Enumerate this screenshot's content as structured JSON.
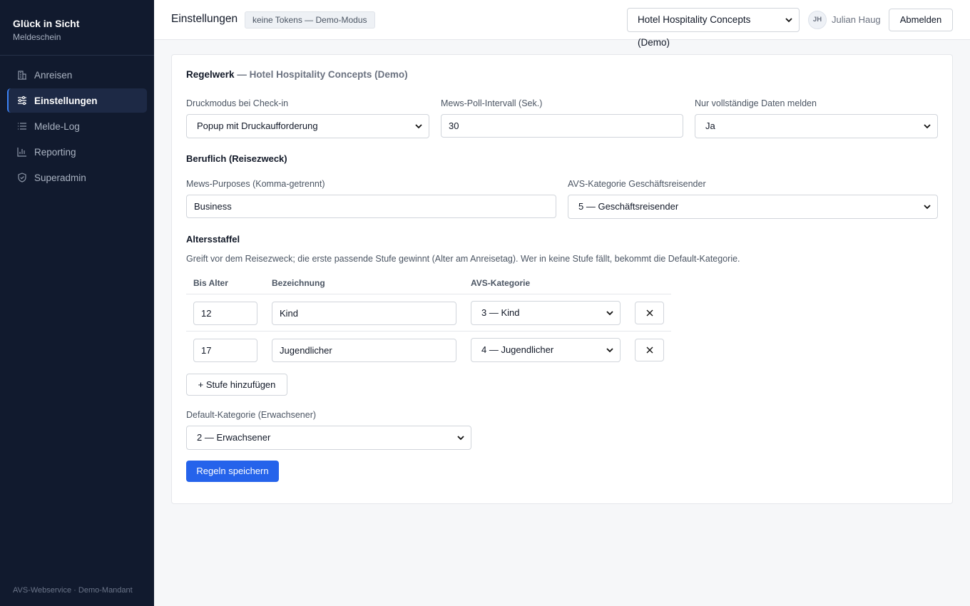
{
  "brand": {
    "title": "Glück in Sicht",
    "subtitle": "Meldeschein"
  },
  "sidebar": {
    "items": [
      {
        "label": "Anreisen",
        "icon": "building-icon",
        "active": false
      },
      {
        "label": "Einstellungen",
        "icon": "sliders-icon",
        "active": true
      },
      {
        "label": "Melde-Log",
        "icon": "list-icon",
        "active": false
      },
      {
        "label": "Reporting",
        "icon": "bar-chart-icon",
        "active": false
      },
      {
        "label": "Superadmin",
        "icon": "shield-icon",
        "active": false
      }
    ],
    "footer": "AVS-Webservice · Demo-Mandant"
  },
  "header": {
    "title": "Einstellungen",
    "mode_badge": "keine Tokens — Demo-Modus",
    "tenant_select": "Hotel Hospitality Concepts (Demo)",
    "avatar_initials": "JH",
    "user_name": "Julian Haug",
    "logout_label": "Abmelden"
  },
  "card": {
    "title": "Regelwerk",
    "title_suffix": "— Hotel Hospitality Concepts (Demo)",
    "druckmodus": {
      "label": "Druckmodus bei Check-in",
      "value": "Popup mit Druckaufforderung"
    },
    "poll": {
      "label": "Mews-Poll-Intervall (Sek.)",
      "value": "30"
    },
    "complete": {
      "label": "Nur vollständige Daten melden",
      "value": "Ja"
    },
    "beruflich": {
      "heading": "Beruflich (Reisezweck)",
      "purposes_label": "Mews-Purposes (Komma-getrennt)",
      "purposes_value": "Business",
      "category_label": "AVS-Kategorie Geschäftsreisender",
      "category_value": "5 — Geschäftsreisender"
    },
    "altersstaffel": {
      "heading": "Altersstaffel",
      "help": "Greift vor dem Reisezweck; die erste passende Stufe gewinnt (Alter am Anreisetag). Wer in keine Stufe fällt, bekommt die Default-Kategorie.",
      "columns": [
        "Bis Alter",
        "Bezeichnung",
        "AVS-Kategorie"
      ],
      "rows": [
        {
          "age": "12",
          "name": "Kind",
          "category": "3 — Kind"
        },
        {
          "age": "17",
          "name": "Jugendlicher",
          "category": "4 — Jugendlicher"
        }
      ],
      "add_label": "+ Stufe hinzufügen"
    },
    "default_category": {
      "label": "Default-Kategorie (Erwachsener)",
      "value": "2 — Erwachsener"
    },
    "save_label": "Regeln speichern"
  },
  "colors": {
    "sidebar_bg": "#111a2e",
    "accent": "#2563eb",
    "active_border": "#3b82f6"
  }
}
